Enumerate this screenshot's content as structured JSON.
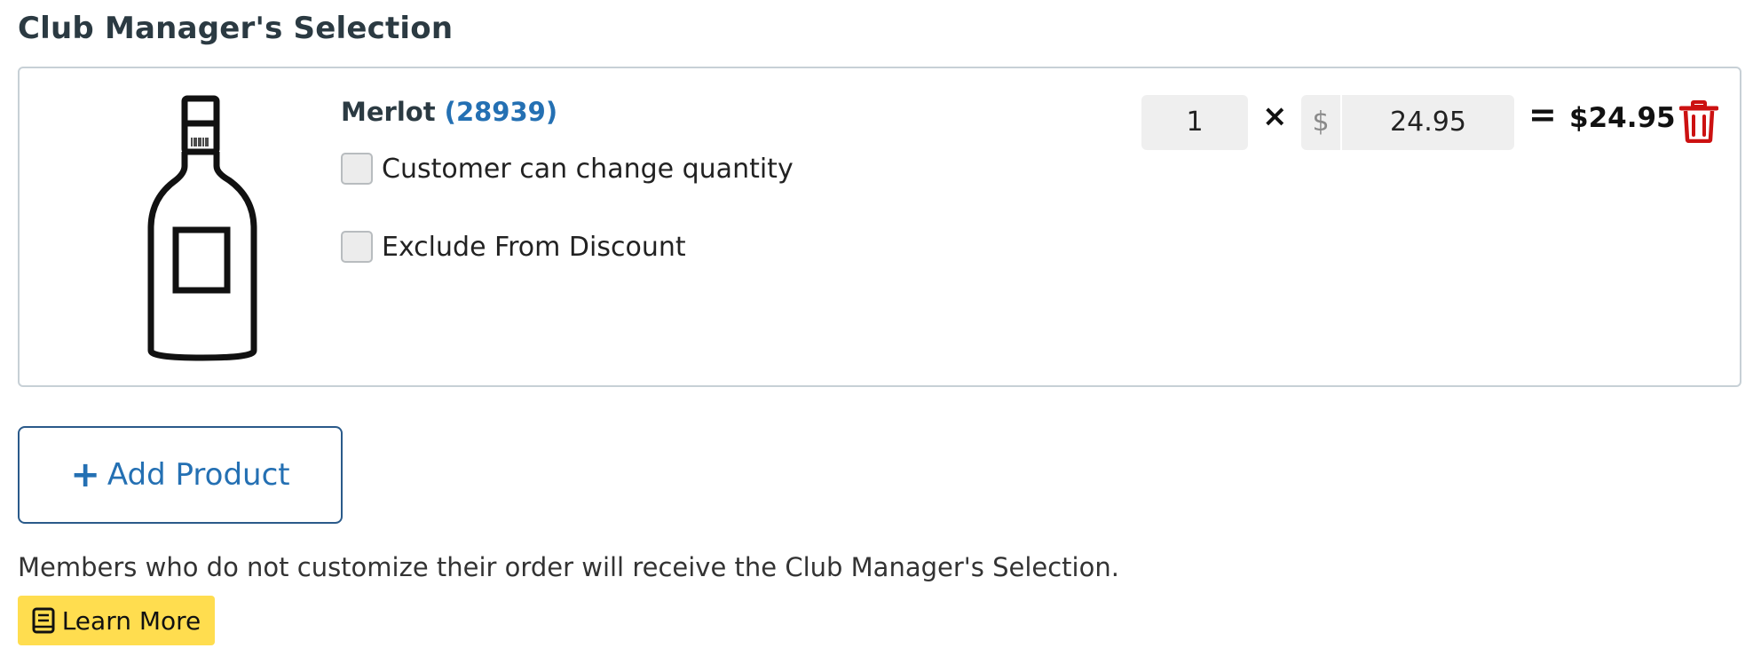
{
  "section": {
    "title": "Club Manager's Selection"
  },
  "product": {
    "name": "Merlot",
    "sku_open": "(",
    "sku": "28939",
    "sku_close": ")",
    "icon": "wine-bottle-icon",
    "options": [
      {
        "label": "Customer can change quantity",
        "checked": false
      },
      {
        "label": "Exclude From Discount",
        "checked": false
      }
    ],
    "quantity": "1",
    "times_symbol": "×",
    "currency_symbol": "$",
    "unit_price": "24.95",
    "equals_symbol": "=",
    "line_total": "$24.95",
    "delete_icon": "trash-icon"
  },
  "actions": {
    "add_product_plus": "+",
    "add_product_label": "Add Product"
  },
  "info": {
    "text": "Members who do not customize their order will receive the Club Manager's Selection.",
    "learn_more_label": "Learn More",
    "learn_more_icon": "book-icon"
  },
  "colors": {
    "link_blue": "#2470b3",
    "danger_red": "#cc1111",
    "learn_more_yellow": "#ffdd4f",
    "text_dark": "#2b3a42"
  }
}
